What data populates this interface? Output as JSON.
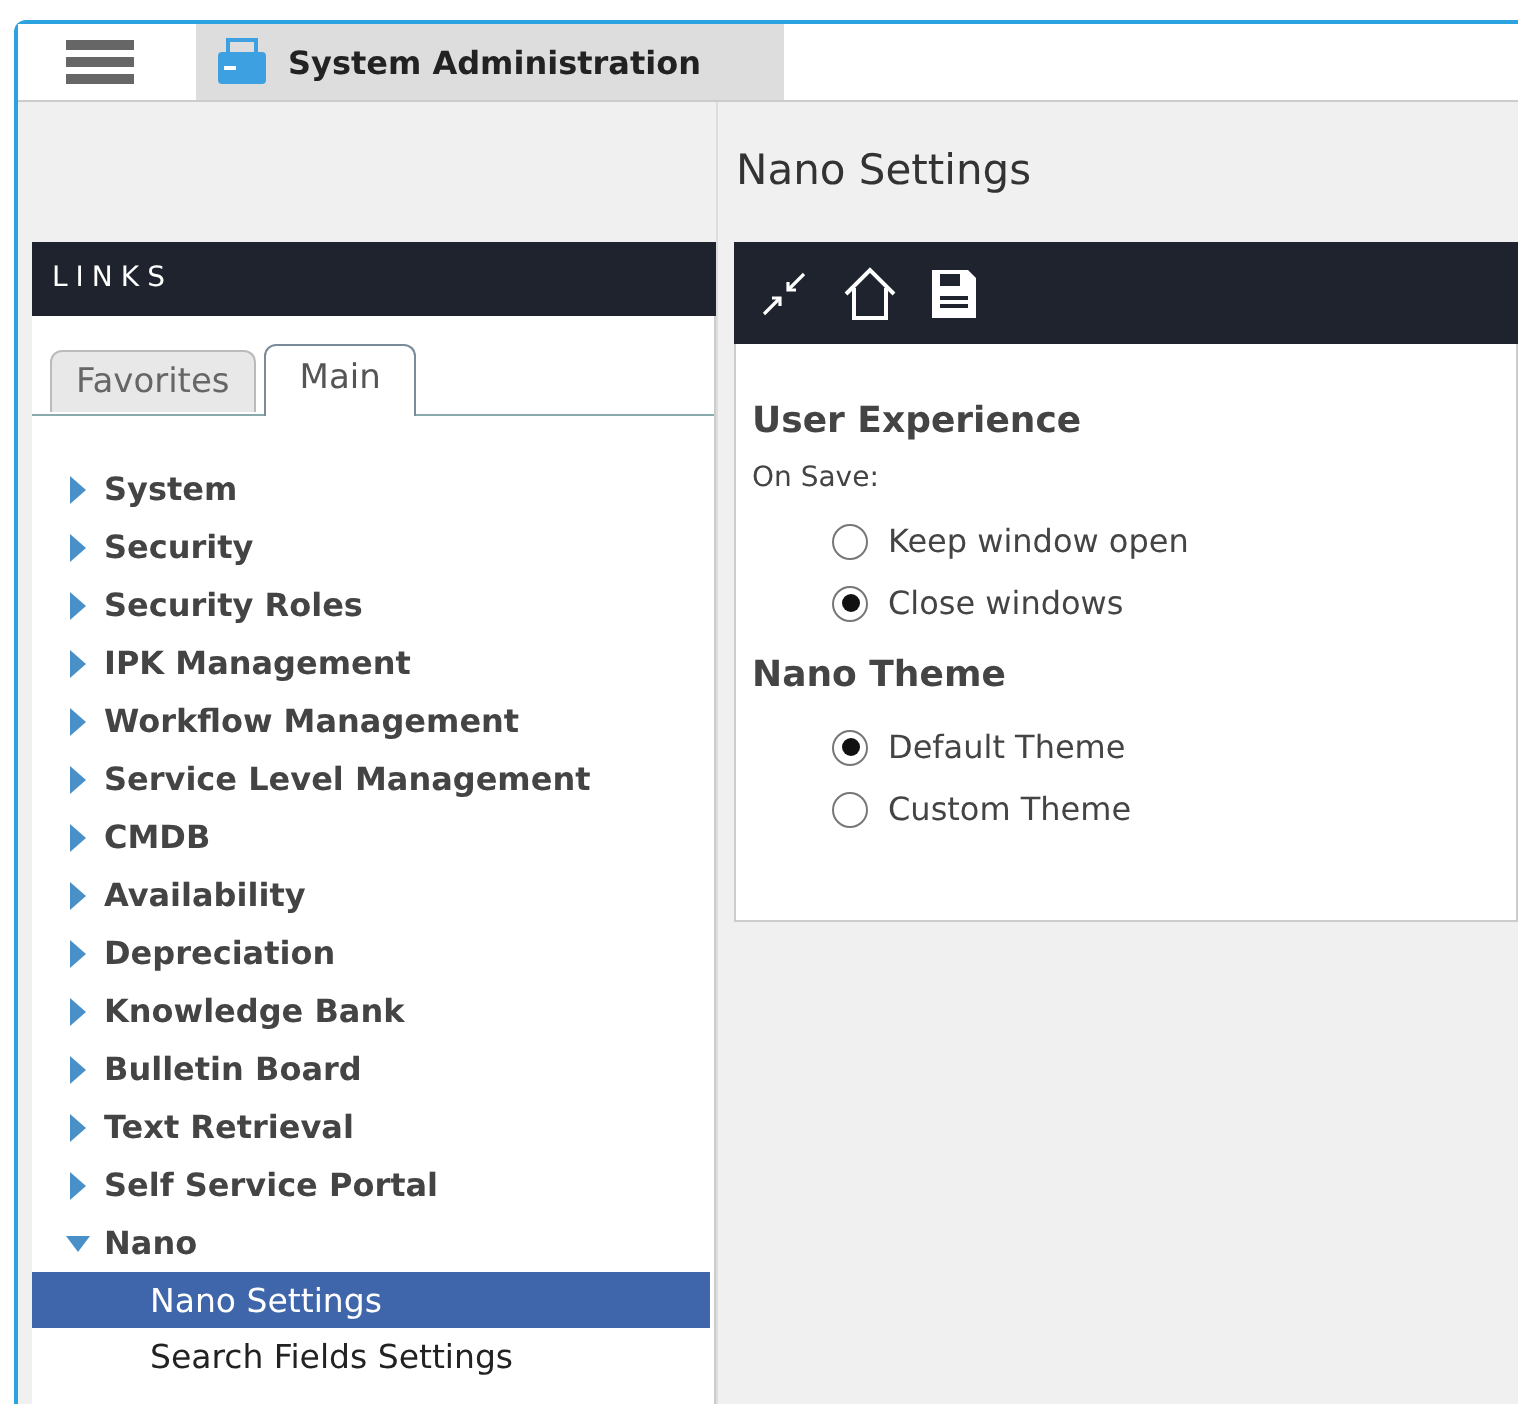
{
  "window_tab": {
    "title": "System Administration"
  },
  "sidebar": {
    "header": "LINKS",
    "tabs": [
      {
        "label": "Favorites",
        "selected": false
      },
      {
        "label": "Main",
        "selected": true
      }
    ],
    "tree": [
      {
        "label": "System",
        "expanded": false
      },
      {
        "label": "Security",
        "expanded": false
      },
      {
        "label": "Security Roles",
        "expanded": false
      },
      {
        "label": "IPK Management",
        "expanded": false
      },
      {
        "label": "Workflow Management",
        "expanded": false
      },
      {
        "label": "Service Level Management",
        "expanded": false
      },
      {
        "label": "CMDB",
        "expanded": false
      },
      {
        "label": "Availability",
        "expanded": false
      },
      {
        "label": "Depreciation",
        "expanded": false
      },
      {
        "label": "Knowledge Bank",
        "expanded": false
      },
      {
        "label": "Bulletin Board",
        "expanded": false
      },
      {
        "label": "Text Retrieval",
        "expanded": false
      },
      {
        "label": "Self Service Portal",
        "expanded": false
      },
      {
        "label": "Nano",
        "expanded": true,
        "children": [
          {
            "label": "Nano Settings",
            "selected": true
          },
          {
            "label": "Search Fields Settings",
            "selected": false
          }
        ]
      }
    ]
  },
  "main": {
    "title": "Nano Settings",
    "sections": [
      {
        "heading": "User Experience",
        "label": "On Save:",
        "options": [
          {
            "label": "Keep window open",
            "selected": false
          },
          {
            "label": "Close windows",
            "selected": true
          }
        ]
      },
      {
        "heading": "Nano Theme",
        "options": [
          {
            "label": "Default Theme",
            "selected": true
          },
          {
            "label": "Custom Theme",
            "selected": false
          }
        ]
      }
    ]
  }
}
